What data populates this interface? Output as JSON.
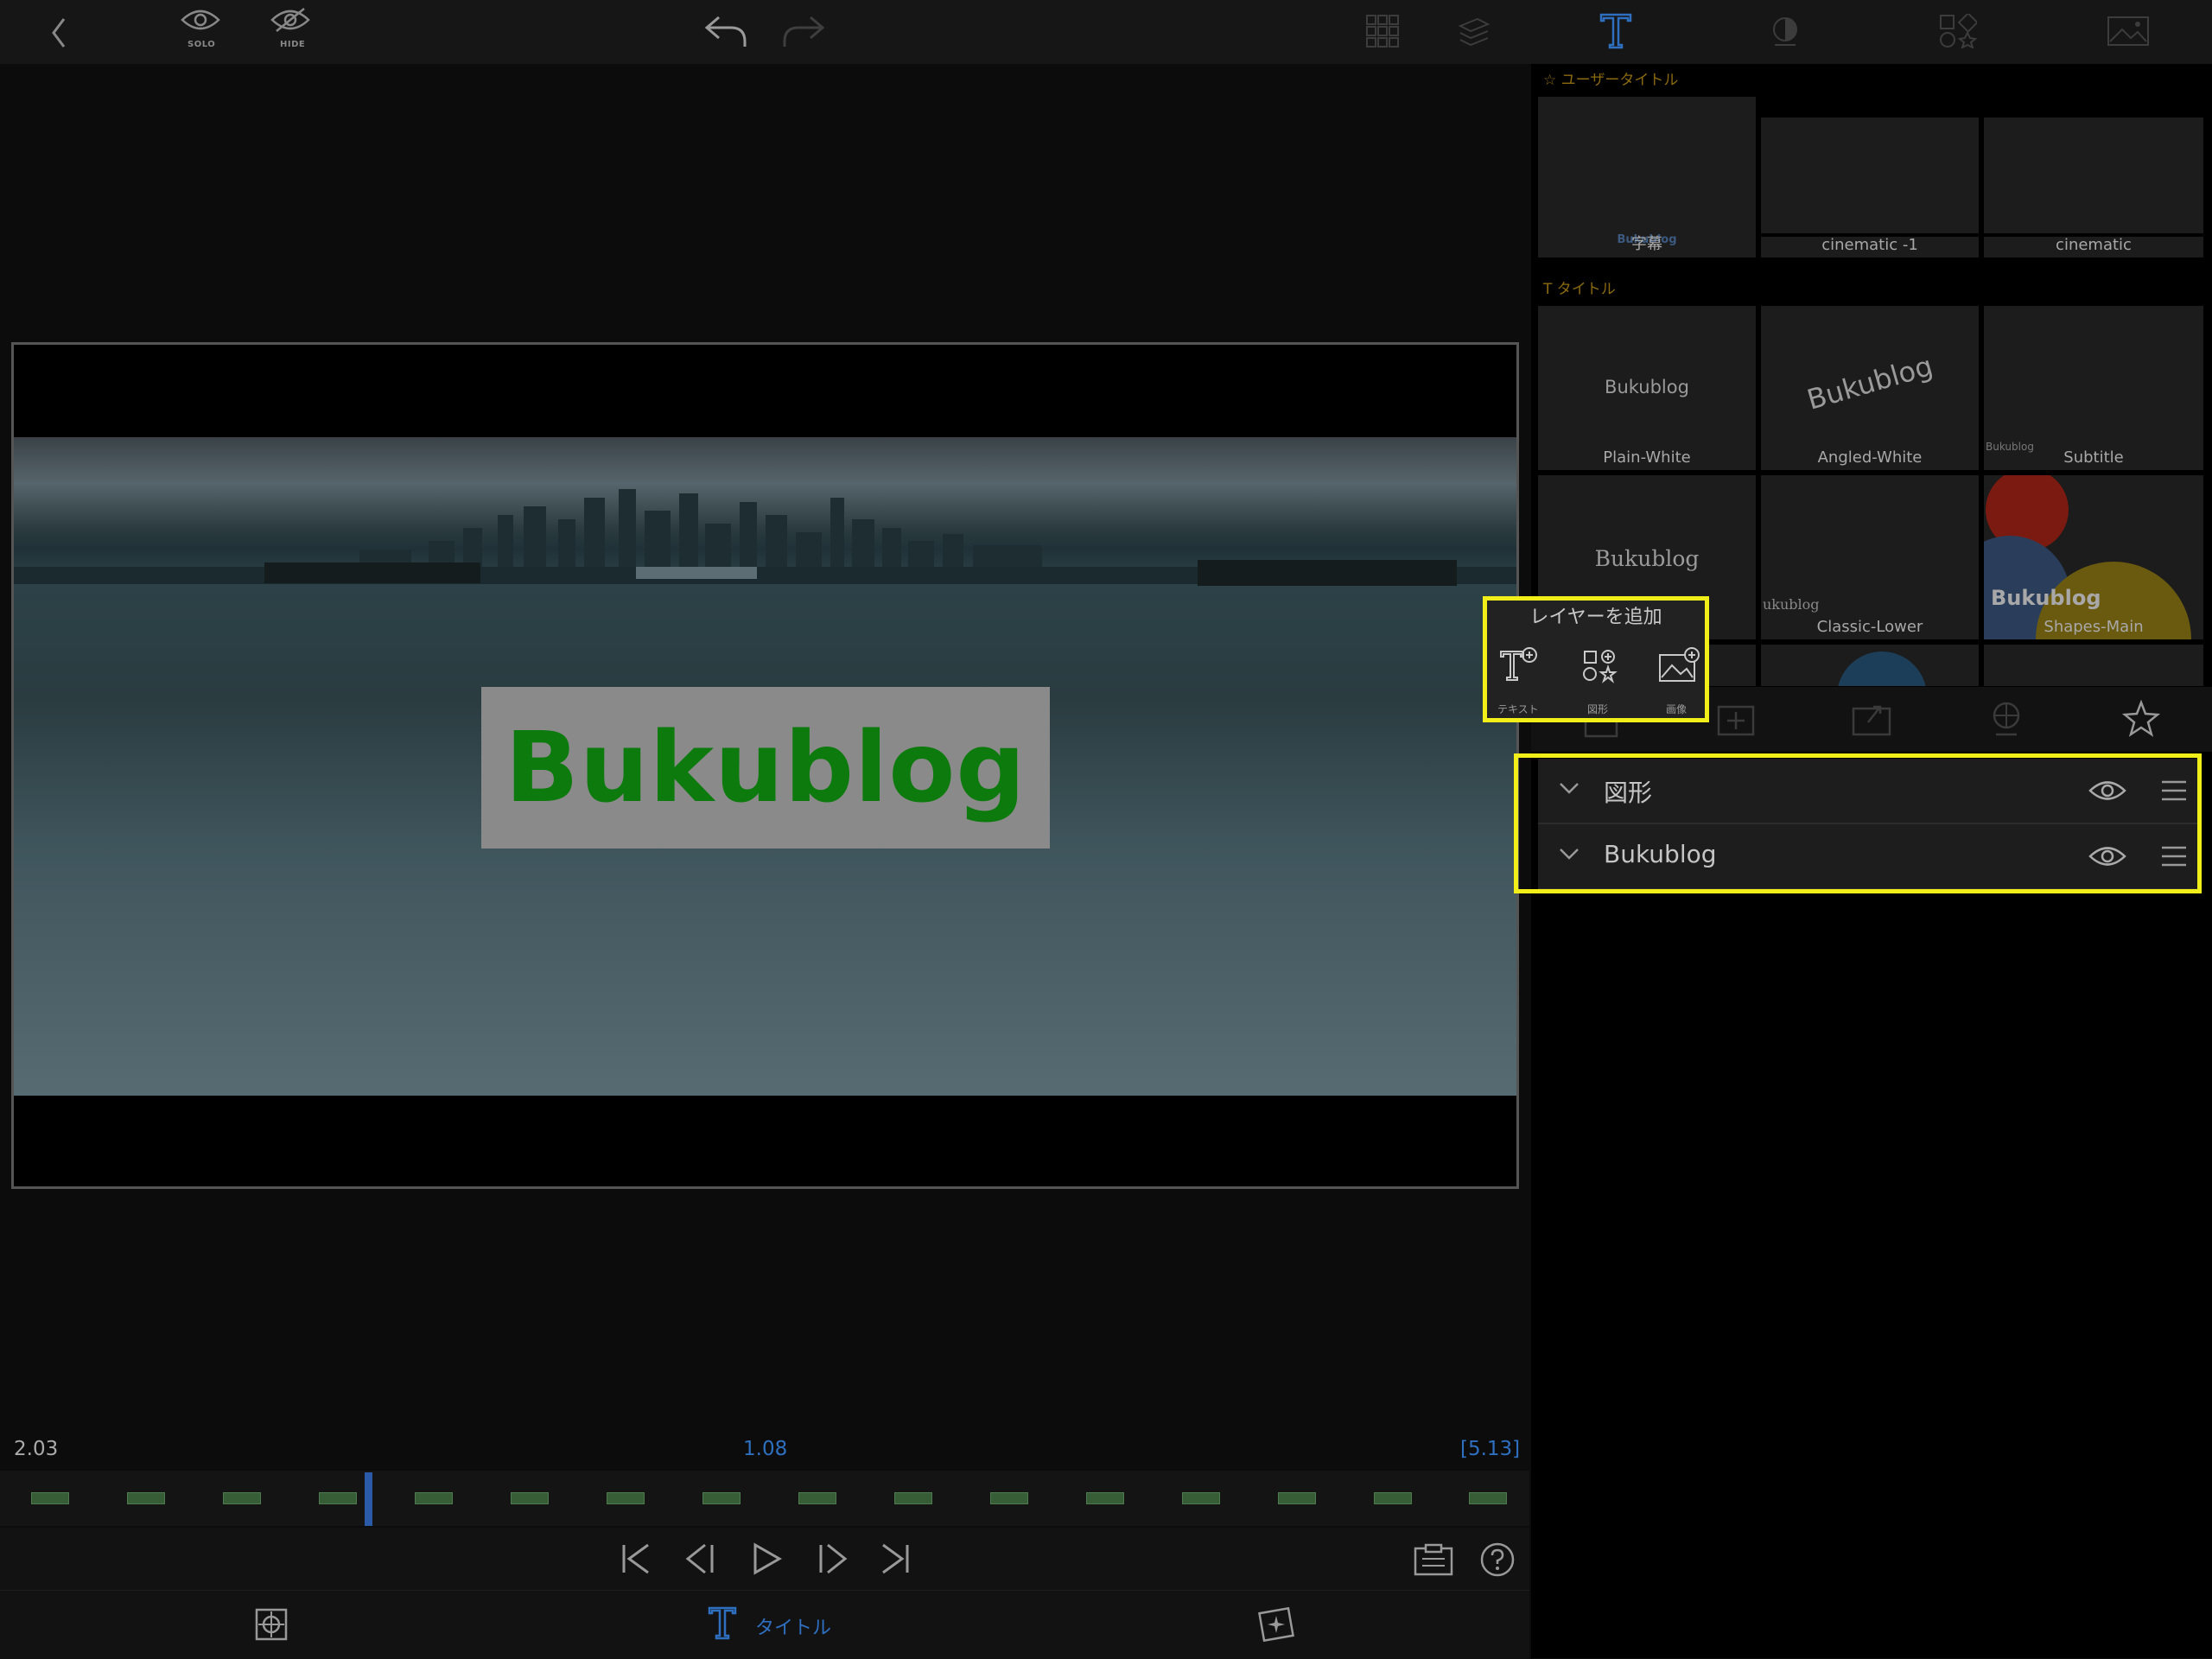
{
  "toolbar": {
    "solo_label": "SOLO",
    "hide_label": "HIDE"
  },
  "preview": {
    "title_text": "Bukublog"
  },
  "timeline": {
    "left_time": "2.03",
    "current_time": "1.08",
    "total_time": "[5.13]"
  },
  "bottom_tabs": {
    "title_label": "タイトル"
  },
  "panel": {
    "user_titles_header": "ユーザータイトル",
    "titles_header": "タイトル",
    "user_presets": [
      {
        "label": "字幕",
        "sample": "Bukublog"
      },
      {
        "label": "cinematic -1"
      },
      {
        "label": "cinematic"
      }
    ],
    "title_presets_row1": [
      {
        "label": "Plain-White",
        "sample": "Bukublog"
      },
      {
        "label": "Angled-White",
        "sample": "Bukublog"
      },
      {
        "label": "Subtitle",
        "sample": "Bukublog"
      }
    ],
    "title_presets_row2": [
      {
        "label": "",
        "sample": "Bukublog"
      },
      {
        "label": "Classic-Lower",
        "sample": "ukublog"
      },
      {
        "label": "Shapes-Main",
        "sample": "Bukublog"
      }
    ]
  },
  "add_layer": {
    "title": "レイヤーを追加",
    "text_label": "テキスト",
    "shape_label": "図形",
    "image_label": "画像"
  },
  "layers": [
    {
      "name": "図形"
    },
    {
      "name": "Bukublog"
    }
  ],
  "colors": {
    "accent_blue": "#2f6fc0",
    "highlight_yellow": "#f2ee1a",
    "title_green": "#0c7a0c",
    "section_gold": "#8a6a10"
  }
}
